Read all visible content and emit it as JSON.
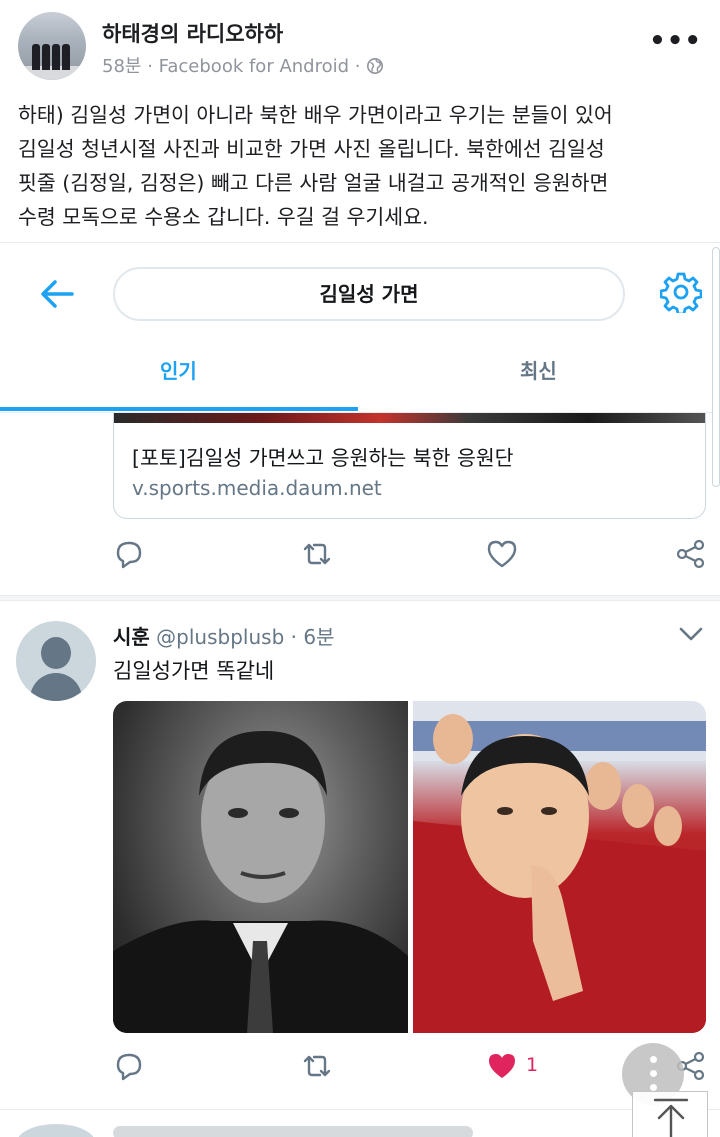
{
  "post": {
    "author": "하태경의 라디오하하",
    "time": "58분",
    "separator": "·",
    "source": "Facebook for Android",
    "separator2": "·",
    "more_label": "•••",
    "body_lines": [
      "하태) 김일성 가면이 아니라 북한 배우 가면이라고 우기는 분들이 있어",
      "김일성 청년시절 사진과 비교한 가면 사진 올립니다. 북한에선 김일성",
      "핏줄 (김정일, 김정은) 빼고 다른 사람 얼굴 내걸고 공개적인 응원하면",
      "수령 모독으로 수용소 갑니다. 우길 걸 우기세요."
    ]
  },
  "twitter": {
    "search_query": "김일성 가면",
    "tabs": [
      {
        "label": "인기",
        "active": true
      },
      {
        "label": "최신",
        "active": false
      }
    ],
    "card": {
      "title": "[포토]김일성 가면쓰고 응원하는 북한 응원단",
      "domain": "v.sports.media.daum.net"
    },
    "tweet": {
      "name": "시훈",
      "handle": "@plusbplusb",
      "dot": "·",
      "time": "6분",
      "text": "김일성가면  똑같네",
      "like_count": "1"
    },
    "colors": {
      "accent": "#1da1f2",
      "like": "#e0245e",
      "icon_gray": "#657786"
    }
  }
}
